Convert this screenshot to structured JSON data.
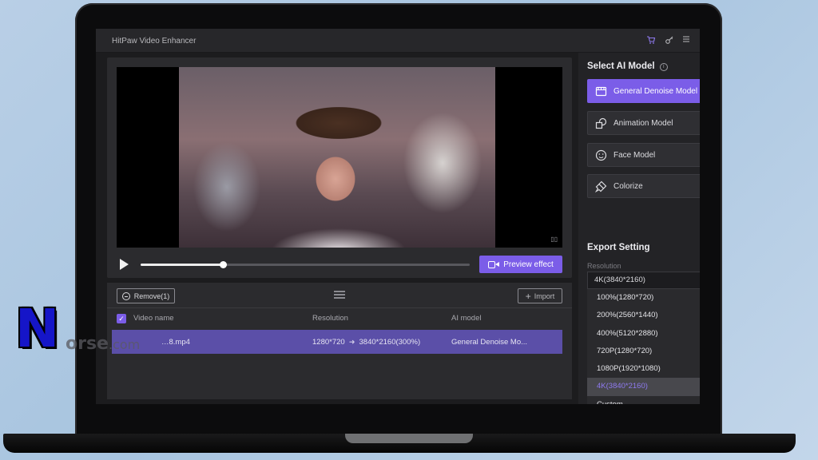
{
  "app": {
    "title": "HitPaw Video Enhancer"
  },
  "titlebar_icons": [
    "cart-icon",
    "key-icon",
    "menu-icon"
  ],
  "player": {
    "progress_fraction": 0.25,
    "preview_label": "Preview effect",
    "watermark_text": "▯▯"
  },
  "toolbar": {
    "remove_label": "Remove(1)",
    "import_label": "Import"
  },
  "table": {
    "headers": {
      "name": "Video name",
      "resolution": "Resolution",
      "model": "AI model"
    },
    "rows": [
      {
        "name": "…8.mp4",
        "from_res": "1280*720",
        "to_res": "3840*2160(300%)",
        "model": "General Denoise Mo..."
      }
    ]
  },
  "watermark": {
    "letter": "N",
    "text": "orse",
    "suffix": ".com"
  },
  "sidebar": {
    "select_model_title": "Select AI Model",
    "models": [
      {
        "label": "General Denoise Model",
        "icon": "film-icon",
        "active": true
      },
      {
        "label": "Animation Model",
        "icon": "shapes-icon",
        "active": false
      },
      {
        "label": "Face Model",
        "icon": "face-icon",
        "active": false
      },
      {
        "label": "Colorize",
        "icon": "brush-icon",
        "active": false
      }
    ],
    "export_title": "Export Setting",
    "resolution_label": "Resolution",
    "resolution_value": "4K(3840*2160)",
    "resolution_options": [
      "100%(1280*720)",
      "200%(2560*1440)",
      "400%(5120*2880)",
      "720P(1280*720)",
      "1080P(1920*1080)",
      "4K(3840*2160)",
      "Custom"
    ],
    "selected_option": "4K(3840*2160)"
  },
  "colors": {
    "accent": "#7b5de8",
    "row_highlight": "#5b4fa8",
    "panel": "#2b2b2e"
  }
}
